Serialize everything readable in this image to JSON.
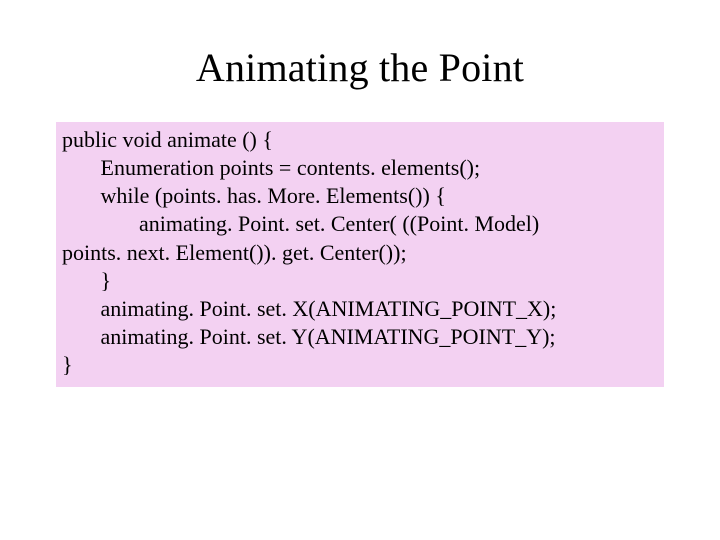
{
  "slide": {
    "title": "Animating the Point",
    "code_lines": [
      "public void animate () {",
      "       Enumeration points = contents. elements();",
      "       while (points. has. More. Elements()) {",
      "              animating. Point. set. Center( ((Point. Model)",
      "points. next. Element()). get. Center());",
      "       }",
      "       animating. Point. set. X(ANIMATING_POINT_X);",
      "       animating. Point. set. Y(ANIMATING_POINT_Y);",
      "}"
    ]
  }
}
